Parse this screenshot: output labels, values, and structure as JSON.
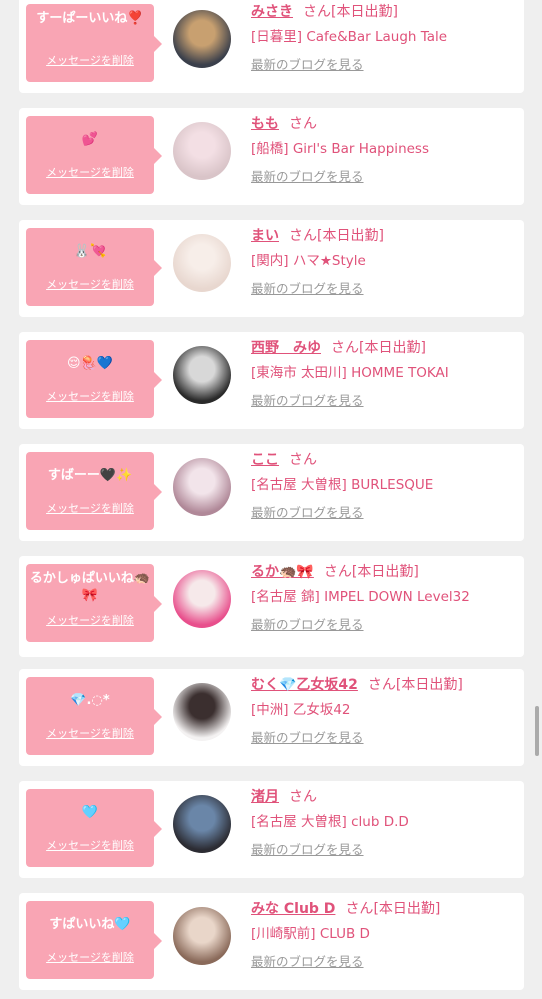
{
  "cards": [
    {
      "message": "すーぱーいいね❣️",
      "delete_label": "メッセージを削除",
      "name": "みさき",
      "san": "さん",
      "status": "[本日出勤]",
      "shop": "[日暮里] Cafe&Bar Laugh Tale",
      "blog_label": "最新のブログを見る",
      "avatar_colors": [
        "#3a3f4b",
        "#c8a070"
      ]
    },
    {
      "message": "💕",
      "delete_label": "メッセージを削除",
      "name": "もも",
      "san": "さん",
      "status": "",
      "shop": "[船橋] Girl's Bar Happiness",
      "blog_label": "最新のブログを見る",
      "avatar_colors": [
        "#d9c4c8",
        "#f3dfe4"
      ]
    },
    {
      "message": "🐰💘",
      "delete_label": "メッセージを削除",
      "name": "まい",
      "san": "さん",
      "status": "[本日出勤]",
      "shop": "[関内] ハマ★Style",
      "blog_label": "最新のブログを見る",
      "avatar_colors": [
        "#e8d7cf",
        "#f7eee9"
      ]
    },
    {
      "message": "😌🪼💙",
      "delete_label": "メッセージを削除",
      "name": "西野　みゆ",
      "san": "さん",
      "status": "[本日出勤]",
      "shop": "[東海市 太田川] HOMME TOKAI",
      "blog_label": "最新のブログを見る",
      "avatar_colors": [
        "#2a2a2a",
        "#d8d8d8"
      ]
    },
    {
      "message": "すばーー🖤✨",
      "delete_label": "メッセージを削除",
      "name": "ここ",
      "san": "さん",
      "status": "",
      "shop": "[名古屋 大曽根] BURLESQUE",
      "blog_label": "最新のブログを見る",
      "avatar_colors": [
        "#b08898",
        "#f2e4ea"
      ]
    },
    {
      "message": "るかしゅぱいいね🦔🎀",
      "delete_label": "メッセージを削除",
      "name": "るか🦔🎀",
      "san": "さん",
      "status": "[本日出勤]",
      "shop": "[名古屋 錦] IMPEL DOWN Level32",
      "blog_label": "最新のブログを見る",
      "avatar_colors": [
        "#e84f8c",
        "#f6e9ea"
      ]
    },
    {
      "message": "💎.◌*",
      "delete_label": "メッセージを削除",
      "name": "むく💎乙女坂42",
      "san": "さん",
      "status": "[本日出勤]",
      "shop": "[中洲] 乙女坂42",
      "blog_label": "最新のブログを見る",
      "avatar_colors": [
        "#f4f2f2",
        "#3b2f2f"
      ]
    },
    {
      "message": "🩵",
      "delete_label": "メッセージを削除",
      "name": "渚月",
      "san": "さん",
      "status": "",
      "shop": "[名古屋 大曽根] club D.D",
      "blog_label": "最新のブログを見る",
      "avatar_colors": [
        "#2c2c33",
        "#6a86a8"
      ]
    },
    {
      "message": "すぱいいね🩵",
      "delete_label": "メッセージを削除",
      "name": "みな Club D",
      "san": "さん",
      "status": "[本日出勤]",
      "shop": "[川崎駅前] CLUB D",
      "blog_label": "最新のブログを見る",
      "avatar_colors": [
        "#8a6a5a",
        "#e9d6c9"
      ]
    }
  ],
  "colors": {
    "accent": "#e0527a",
    "bubble": "#f9a5b4",
    "background": "#efefef"
  }
}
